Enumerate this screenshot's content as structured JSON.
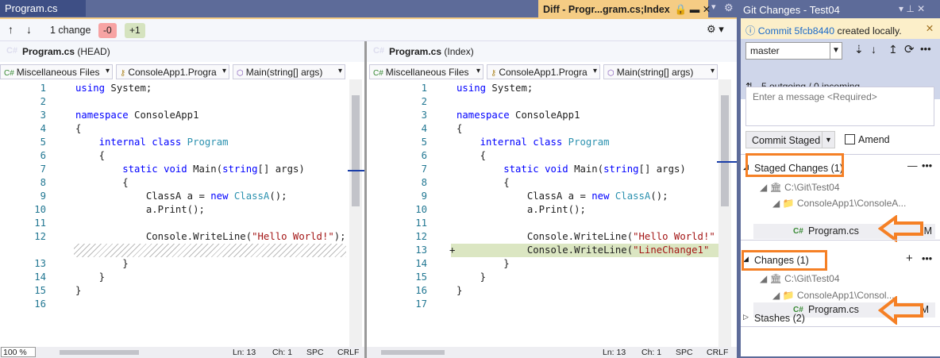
{
  "tabs": {
    "left": "Program.cs",
    "diff": "Diff - Progr...gram.cs;Index",
    "diff_icons": "🔒 ▬ ✕"
  },
  "toolbar": {
    "up": "↑",
    "down": "↓",
    "change_count": "1 change",
    "removed": "-0",
    "added": "+1",
    "settings": "⚙ ▾"
  },
  "left_pane": {
    "file": "Program.cs",
    "label": "(HEAD)",
    "project": "Miscellaneous Files",
    "class": "ConsoleApp1.Progra",
    "member": "Main(string[] args)",
    "lines": [
      {
        "n": "1",
        "s": [
          [
            "using ",
            "kw"
          ],
          [
            "System;",
            ""
          ]
        ]
      },
      {
        "n": "2",
        "s": []
      },
      {
        "n": "3",
        "s": [
          [
            "namespace ",
            "kw"
          ],
          [
            "ConsoleApp1",
            ""
          ]
        ]
      },
      {
        "n": "4",
        "s": [
          [
            "{",
            ""
          ]
        ]
      },
      {
        "n": "5",
        "s": [
          [
            "    internal ",
            "kw"
          ],
          [
            "class ",
            "kw"
          ],
          [
            "Program",
            "ty"
          ]
        ]
      },
      {
        "n": "6",
        "s": [
          [
            "    {",
            ""
          ]
        ]
      },
      {
        "n": "7",
        "s": [
          [
            "        static ",
            "kw"
          ],
          [
            "void ",
            "kw"
          ],
          [
            "Main(",
            ""
          ],
          [
            "string",
            "kw"
          ],
          [
            "[] args)",
            ""
          ]
        ]
      },
      {
        "n": "8",
        "s": [
          [
            "        {",
            ""
          ]
        ]
      },
      {
        "n": "9",
        "s": [
          [
            "            ClassA a = ",
            ""
          ],
          [
            "new ",
            "kw"
          ],
          [
            "ClassA",
            "ty"
          ],
          [
            "();",
            ""
          ]
        ]
      },
      {
        "n": "10",
        "s": [
          [
            "            a.Print();",
            ""
          ]
        ]
      },
      {
        "n": "11",
        "s": []
      },
      {
        "n": "12",
        "s": [
          [
            "            Console.WriteLine(",
            ""
          ],
          [
            "\"Hello World!\"",
            "st"
          ],
          [
            ");",
            ""
          ]
        ]
      },
      {
        "n": "",
        "s": [],
        "hatch": true
      },
      {
        "n": "13",
        "s": [
          [
            "        }",
            ""
          ]
        ]
      },
      {
        "n": "14",
        "s": [
          [
            "    }",
            ""
          ]
        ]
      },
      {
        "n": "15",
        "s": [
          [
            "}",
            ""
          ]
        ]
      },
      {
        "n": "16",
        "s": []
      }
    ],
    "status": {
      "zoom": "100 %",
      "ln": "Ln: 13",
      "ch": "Ch: 1",
      "spc": "SPC",
      "eol": "CRLF"
    }
  },
  "right_pane": {
    "file": "Program.cs",
    "label": "(Index)",
    "project": "Miscellaneous Files",
    "class": "ConsoleApp1.Progra",
    "member": "Main(string[] args)",
    "lines": [
      {
        "n": "1",
        "s": [
          [
            "using ",
            "kw"
          ],
          [
            "System;",
            ""
          ]
        ]
      },
      {
        "n": "2",
        "s": []
      },
      {
        "n": "3",
        "s": [
          [
            "namespace ",
            "kw"
          ],
          [
            "ConsoleApp1",
            ""
          ]
        ]
      },
      {
        "n": "4",
        "s": [
          [
            "{",
            ""
          ]
        ]
      },
      {
        "n": "5",
        "s": [
          [
            "    internal ",
            "kw"
          ],
          [
            "class ",
            "kw"
          ],
          [
            "Program",
            "ty"
          ]
        ]
      },
      {
        "n": "6",
        "s": [
          [
            "    {",
            ""
          ]
        ]
      },
      {
        "n": "7",
        "s": [
          [
            "        static ",
            "kw"
          ],
          [
            "void ",
            "kw"
          ],
          [
            "Main(",
            ""
          ],
          [
            "string",
            "kw"
          ],
          [
            "[] args)",
            ""
          ]
        ]
      },
      {
        "n": "8",
        "s": [
          [
            "        {",
            ""
          ]
        ]
      },
      {
        "n": "9",
        "s": [
          [
            "            ClassA a = ",
            ""
          ],
          [
            "new ",
            "kw"
          ],
          [
            "ClassA",
            "ty"
          ],
          [
            "();",
            ""
          ]
        ]
      },
      {
        "n": "10",
        "s": [
          [
            "            a.Print();",
            ""
          ]
        ]
      },
      {
        "n": "11",
        "s": []
      },
      {
        "n": "12",
        "s": [
          [
            "            Console.WriteLine(",
            ""
          ],
          [
            "\"Hello World!\"",
            "st"
          ]
        ]
      },
      {
        "n": "13",
        "s": [
          [
            "            Console.WriteLine(",
            ""
          ],
          [
            "\"LineChange1\"",
            "st"
          ]
        ],
        "added": true,
        "marker": "+"
      },
      {
        "n": "14",
        "s": [
          [
            "        }",
            ""
          ]
        ]
      },
      {
        "n": "15",
        "s": [
          [
            "    }",
            ""
          ]
        ]
      },
      {
        "n": "16",
        "s": [
          [
            "}",
            ""
          ]
        ]
      },
      {
        "n": "17",
        "s": []
      }
    ],
    "status": {
      "ln": "Ln: 13",
      "ch": "Ch: 1",
      "spc": "SPC",
      "eol": "CRLF"
    }
  },
  "git": {
    "title": "Git Changes - Test04",
    "title_icons": "▾ ⊥ ✕",
    "info": {
      "pre": "Commit ",
      "link": "5fcb8440",
      "post": " created locally."
    },
    "branch": "master",
    "sync": "5 outgoing / 0 incoming",
    "message_placeholder": "Enter a message <Required>",
    "commit_button": "Commit Staged",
    "amend": "Amend",
    "staged": {
      "title": "Staged Changes (1)",
      "repo": "C:\\Git\\Test04",
      "folder": "ConsoleApp1\\ConsoleA...",
      "file": "Program.cs",
      "status": "M"
    },
    "changes": {
      "title": "Changes (1)",
      "repo": "C:\\Git\\Test04",
      "folder": "ConsoleApp1\\Consol...",
      "file": "Program.cs",
      "status": "M"
    },
    "stashes": "Stashes (2)",
    "highlight_color": "#f58025"
  }
}
